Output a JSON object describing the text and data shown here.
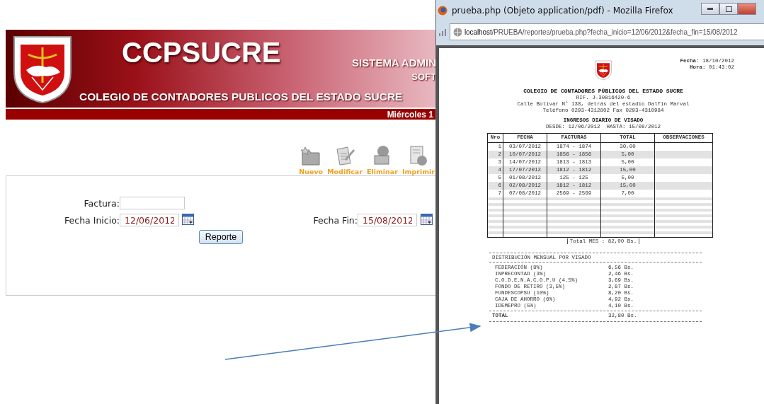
{
  "web_page": {
    "header": {
      "title": "CCPSUCRE",
      "subtitle": "COLEGIO DE CONTADORES PUBLICOS DEL ESTADO SUCRE",
      "system_text": "SISTEMA ADMIN",
      "system_subtext": "SOFT"
    },
    "date_bar": "Miércoles 1",
    "toolbar": [
      {
        "label": "Nuevo",
        "kind": "new"
      },
      {
        "label": "Modificar",
        "kind": "edit"
      },
      {
        "label": "Eliminar",
        "kind": "delete"
      },
      {
        "label": "Imprimir",
        "kind": "print"
      }
    ],
    "form": {
      "factura": {
        "label": "Factura:"
      },
      "fecha_inicio": {
        "label": "Fecha Inicio:",
        "value": "12/06/2012"
      },
      "fecha_fin": {
        "label": "Fecha Fin:",
        "value": "15/08/2012"
      },
      "button": "Reporte"
    }
  },
  "browser_window": {
    "title": "prueba.php (Objeto application/pdf) - Mozilla Firefox",
    "url_host": "localhost",
    "url_path": "/PRUEBA/reportes/prueba.php?fecha_inicio=12/06/2012&fecha_fin=15/08/2012",
    "report": {
      "fecha_label": "Fecha:",
      "fecha": "18/10/2012",
      "hora_label": "Hora:",
      "hora": "01:43:02",
      "org": "COLEGIO DE CONTADORES PÚBLICOS DEL ESTADO SUCRE",
      "rif": "RIF. J-30816420-6",
      "address": "Calle Bolívar N° 138, detrás del estadio Dalfín Marval",
      "phone": "Teléfono 0293-4312802 Fax 0293-4310984",
      "report_title": "INGRESOS DIARIO DE VISADO",
      "range": "DESDE: 12/06/2012  HASTA: 15/08/2012",
      "table": {
        "columns": [
          "Nro",
          "FECHA",
          "FACTURAS",
          "TOTAL",
          "OBSERVACIONES"
        ],
        "rows": [
          [
            "1",
            "03/07/2012",
            "1874 - 1874",
            "30,00"
          ],
          [
            "2",
            "10/07/2012",
            "1856 - 1856",
            "5,00"
          ],
          [
            "3",
            "14/07/2012",
            "1813 - 1813",
            "5,00"
          ],
          [
            "4",
            "17/07/2012",
            "1812 - 1812",
            "15,00"
          ],
          [
            "5",
            "01/08/2012",
            "125 - 125",
            "5,00"
          ],
          [
            "6",
            "02/08/2012",
            "1812 - 1812",
            "15,00"
          ],
          [
            "7",
            "07/08/2012",
            "2569 - 2569",
            "7,00"
          ]
        ]
      },
      "total_mes": "Total MES : 82,00 Bs.",
      "distribution": {
        "title": "DISTRIBUCIÓN MENSUAL POR VISADO",
        "items": [
          {
            "name": "FEDERACIÓN (8%)",
            "amount": "6,56 Bs."
          },
          {
            "name": "INPRECONTAD (3%)",
            "amount": "2,46 Bs."
          },
          {
            "name": "C.O.D.E.N.A.C.O.P.U (4.5%)",
            "amount": "3,69 Bs."
          },
          {
            "name": "FONDO DE RETIRO (3,5%)",
            "amount": "2,87 Bs."
          },
          {
            "name": "FUNDESCOPSU (10%)",
            "amount": "8,20 Bs."
          },
          {
            "name": "CAJA DE AHORRO (6%)",
            "amount": "4,92 Bs."
          },
          {
            "name": "IDEMEPRO (5%)",
            "amount": "4,10 Bs."
          }
        ],
        "total_label": "TOTAL",
        "total": "32,80 Bs."
      }
    }
  }
}
